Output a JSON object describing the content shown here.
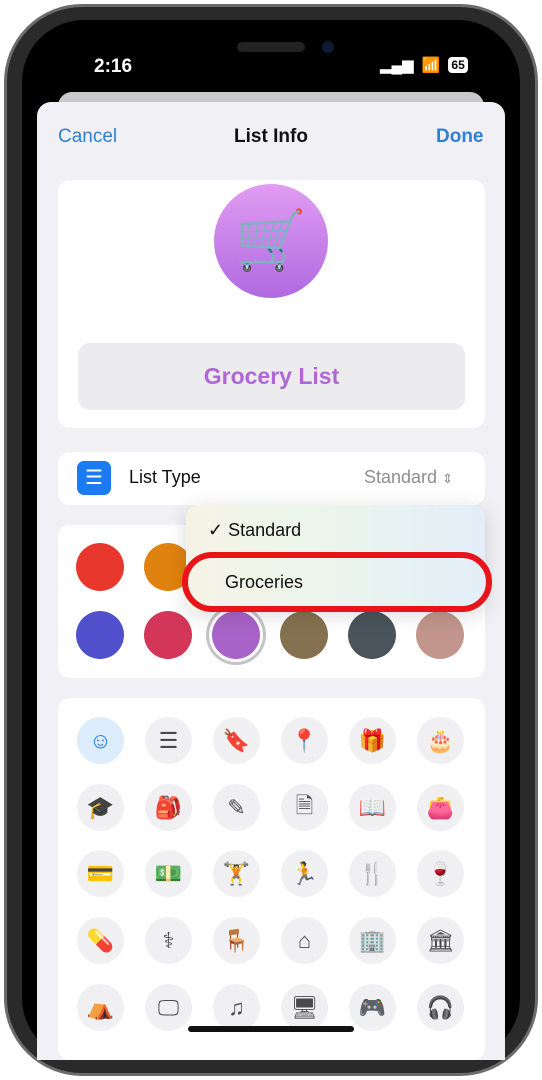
{
  "status_bar": {
    "time": "2:16",
    "battery": "65",
    "signal_icon": "signal-icon",
    "wifi_icon": "wifi-icon"
  },
  "nav": {
    "cancel": "Cancel",
    "title": "List Info",
    "done": "Done"
  },
  "list": {
    "icon": "cart-icon",
    "name": "Grocery List",
    "accent": "#b067d6"
  },
  "list_type": {
    "label": "List Type",
    "value": "Standard",
    "icon": "list-bullet-icon"
  },
  "menu": {
    "options": [
      {
        "label": "Standard",
        "checked": true
      },
      {
        "label": "Groceries",
        "checked": false,
        "highlighted": true
      }
    ]
  },
  "colors": [
    "#e8382e",
    "#e0820f",
    "#5050cc",
    "#d33659",
    "#a962c8",
    "#857150",
    "#4a545c",
    "#c2968c"
  ],
  "selected_color": "#a962c8",
  "icons": [
    {
      "name": "smiley-icon",
      "glyph": "☺",
      "selected": true
    },
    {
      "name": "list-icon",
      "glyph": "☰"
    },
    {
      "name": "bookmark-icon",
      "glyph": "🔖"
    },
    {
      "name": "pin-icon",
      "glyph": "📍"
    },
    {
      "name": "gift-icon",
      "glyph": "🎁"
    },
    {
      "name": "cake-icon",
      "glyph": "🎂"
    },
    {
      "name": "graduation-cap-icon",
      "glyph": "🎓"
    },
    {
      "name": "backpack-icon",
      "glyph": "🎒"
    },
    {
      "name": "pencil-ruler-icon",
      "glyph": "✎"
    },
    {
      "name": "document-icon",
      "glyph": "🗎"
    },
    {
      "name": "book-icon",
      "glyph": "📖"
    },
    {
      "name": "wallet-icon",
      "glyph": "👛"
    },
    {
      "name": "credit-card-icon",
      "glyph": "💳"
    },
    {
      "name": "money-icon",
      "glyph": "💵"
    },
    {
      "name": "dumbbell-icon",
      "glyph": "🏋"
    },
    {
      "name": "running-icon",
      "glyph": "🏃"
    },
    {
      "name": "fork-knife-icon",
      "glyph": "🍴"
    },
    {
      "name": "wine-glass-icon",
      "glyph": "🍷"
    },
    {
      "name": "pills-icon",
      "glyph": "💊"
    },
    {
      "name": "stethoscope-icon",
      "glyph": "⚕"
    },
    {
      "name": "chair-icon",
      "glyph": "🪑"
    },
    {
      "name": "house-icon",
      "glyph": "⌂"
    },
    {
      "name": "building-icon",
      "glyph": "🏢"
    },
    {
      "name": "bank-icon",
      "glyph": "🏛"
    },
    {
      "name": "tent-icon",
      "glyph": "⛺"
    },
    {
      "name": "tv-icon",
      "glyph": "🖵"
    },
    {
      "name": "music-note-icon",
      "glyph": "♫"
    },
    {
      "name": "computer-icon",
      "glyph": "🖥"
    },
    {
      "name": "gamecontroller-icon",
      "glyph": "🎮"
    },
    {
      "name": "headphones-icon",
      "glyph": "🎧"
    }
  ]
}
